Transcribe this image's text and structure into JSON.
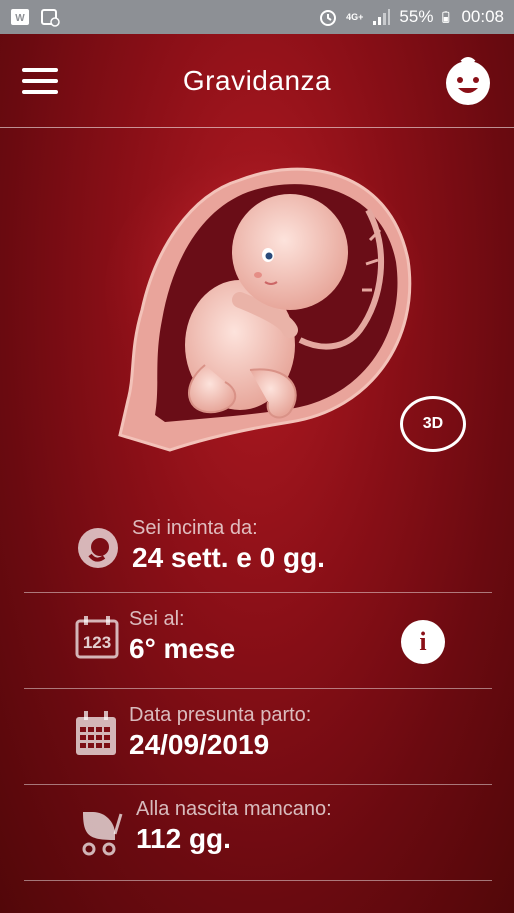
{
  "status_bar": {
    "battery": "55%",
    "time": "00:08",
    "network": "4G+"
  },
  "app_bar": {
    "title": "Gravidanza"
  },
  "view_3d_label": "3D",
  "info_rows": [
    {
      "label": "Sei incinta da:",
      "value": "24 sett. e 0 gg.",
      "icon": "fetus-icon"
    },
    {
      "label": "Sei al:",
      "value": "6° mese",
      "icon": "calendar-123-icon"
    },
    {
      "label": "Data presunta parto:",
      "value": "24/09/2019",
      "icon": "calendar-grid-icon"
    },
    {
      "label": "Alla nascita mancano:",
      "value": "112 gg.",
      "icon": "stroller-icon"
    }
  ],
  "info_button_glyph": "i",
  "colors": {
    "background": "#8a0f17",
    "status_bar": "#8d9095",
    "text": "#ffffff"
  }
}
